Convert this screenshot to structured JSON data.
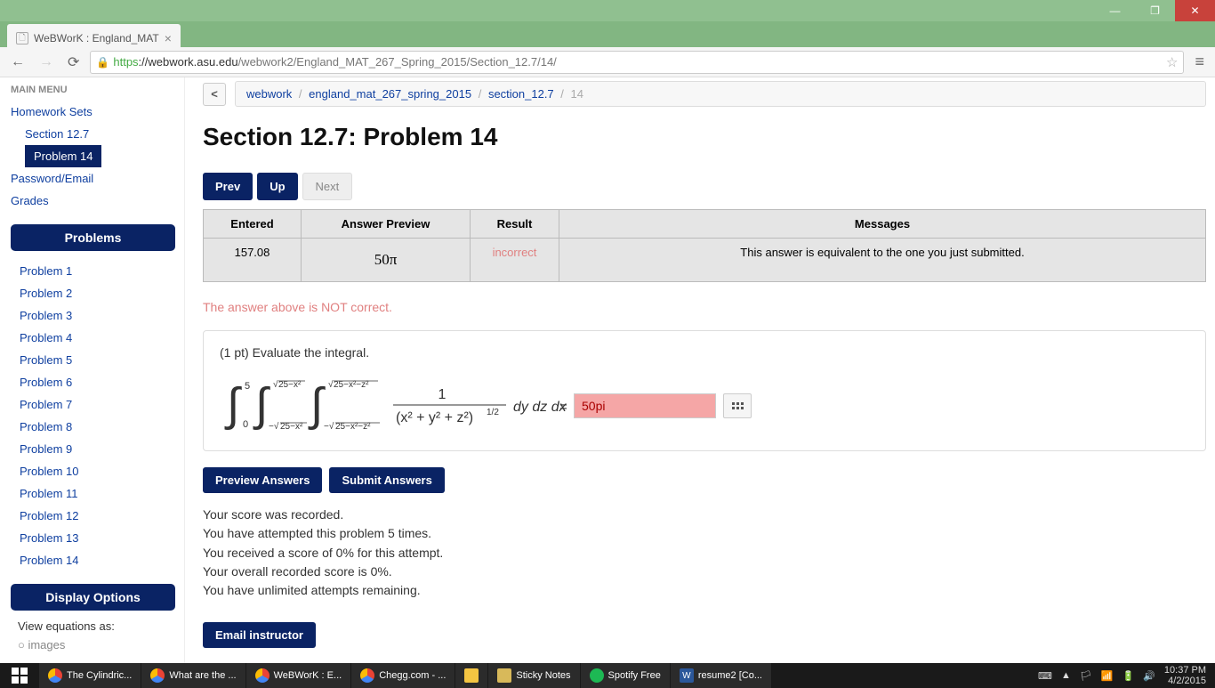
{
  "browser": {
    "tab_title": "WeBWorK : England_MAT",
    "url_scheme": "https",
    "url_host": "://webwork.asu.edu",
    "url_path": "/webwork2/England_MAT_267_Spring_2015/Section_12.7/14/"
  },
  "breadcrumb": {
    "items": [
      "webwork",
      "england_mat_267_spring_2015",
      "section_12.7"
    ],
    "current": "14"
  },
  "sidebar": {
    "main_menu_label": "MAIN MENU",
    "links": {
      "homework_sets": "Homework Sets",
      "section_link": "Section 12.7",
      "problem_active": "Problem 14",
      "password": "Password/Email",
      "grades": "Grades"
    },
    "problems_header": "Problems",
    "problem_labels": [
      "Problem 1",
      "Problem 2",
      "Problem 3",
      "Problem 4",
      "Problem 5",
      "Problem 6",
      "Problem 7",
      "Problem 8",
      "Problem 9",
      "Problem 10",
      "Problem 11",
      "Problem 12",
      "Problem 13",
      "Problem 14"
    ],
    "display_header": "Display Options",
    "display_text": "View equations as:",
    "display_opt1": "images"
  },
  "page": {
    "title": "Section 12.7: Problem 14",
    "nav": {
      "prev": "Prev",
      "up": "Up",
      "next": "Next"
    }
  },
  "result_table": {
    "headers": [
      "Entered",
      "Answer Preview",
      "Result",
      "Messages"
    ],
    "entered": "157.08",
    "preview": "50π",
    "result": "incorrect",
    "message": "This answer is equivalent to the one you just submitted."
  },
  "error_msg": "The answer above is NOT correct.",
  "problem": {
    "prompt": "(1 pt) Evaluate the integral.",
    "outer_lims": [
      "5",
      "0"
    ],
    "mid_upper": "√(25−x²)",
    "mid_lower": "−√(25−x²)",
    "inner_upper": "√(25−x²−z²)",
    "inner_lower": "−√(25−x²−z²)",
    "integrand_num": "1",
    "integrand_den": "(x² + y² + z²)^(1/2)",
    "diff": "dy dz dx =",
    "answer_value": "50pi"
  },
  "buttons": {
    "preview": "Preview Answers",
    "submit": "Submit Answers",
    "email": "Email instructor"
  },
  "score": [
    "Your score was recorded.",
    "You have attempted this problem 5 times.",
    "You received a score of 0% for this attempt.",
    "Your overall recorded score is 0%.",
    "You have unlimited attempts remaining."
  ],
  "taskbar": {
    "items": [
      {
        "name": "The Cylindric...",
        "icon": "chrome"
      },
      {
        "name": "What are the ...",
        "icon": "chrome"
      },
      {
        "name": "WeBWorK : E...",
        "icon": "chrome"
      },
      {
        "name": "Chegg.com - ...",
        "icon": "chrome"
      },
      {
        "name": "",
        "icon": "folder"
      },
      {
        "name": "Sticky Notes",
        "icon": "sticky"
      },
      {
        "name": "Spotify Free",
        "icon": "spotify"
      },
      {
        "name": "resume2 [Co...",
        "icon": "word"
      }
    ],
    "time": "10:37 PM",
    "date": "4/2/2015"
  }
}
